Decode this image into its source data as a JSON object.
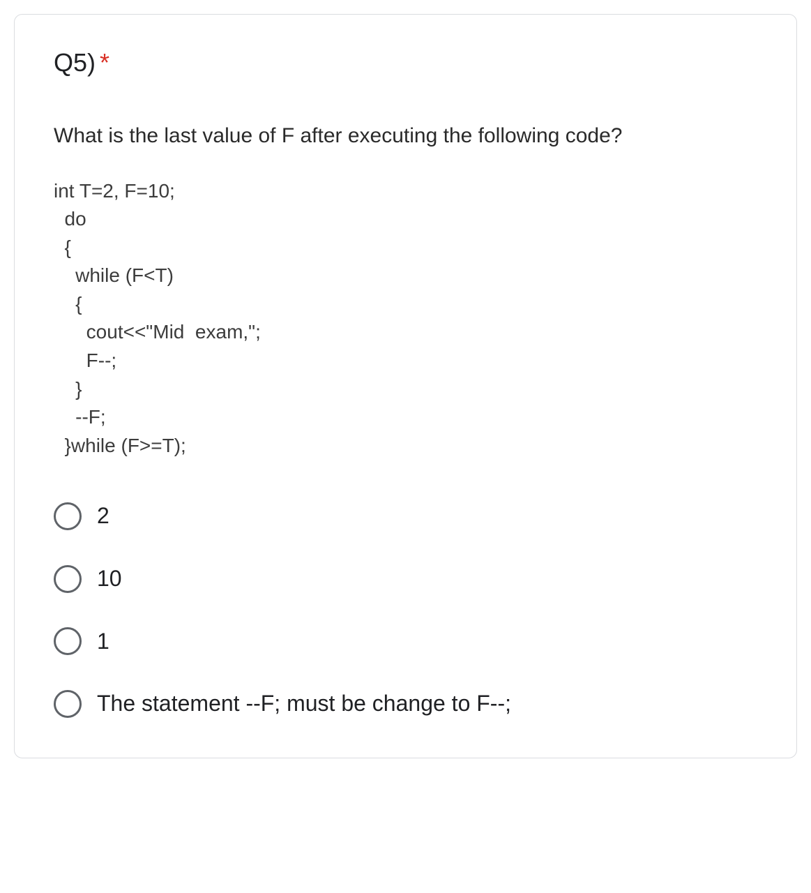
{
  "question": {
    "number": "Q5)",
    "required_mark": "*",
    "prompt": "What is the last value of F after executing the following code?",
    "code": "int T=2, F=10;\n  do\n  {\n    while (F<T)\n    {\n      cout<<\"Mid  exam,\";\n      F--;\n    }\n    --F;\n  }while (F>=T);"
  },
  "options": [
    {
      "label": "2"
    },
    {
      "label": "10"
    },
    {
      "label": "1"
    },
    {
      "label": "The statement --F; must be change to F--;"
    }
  ]
}
